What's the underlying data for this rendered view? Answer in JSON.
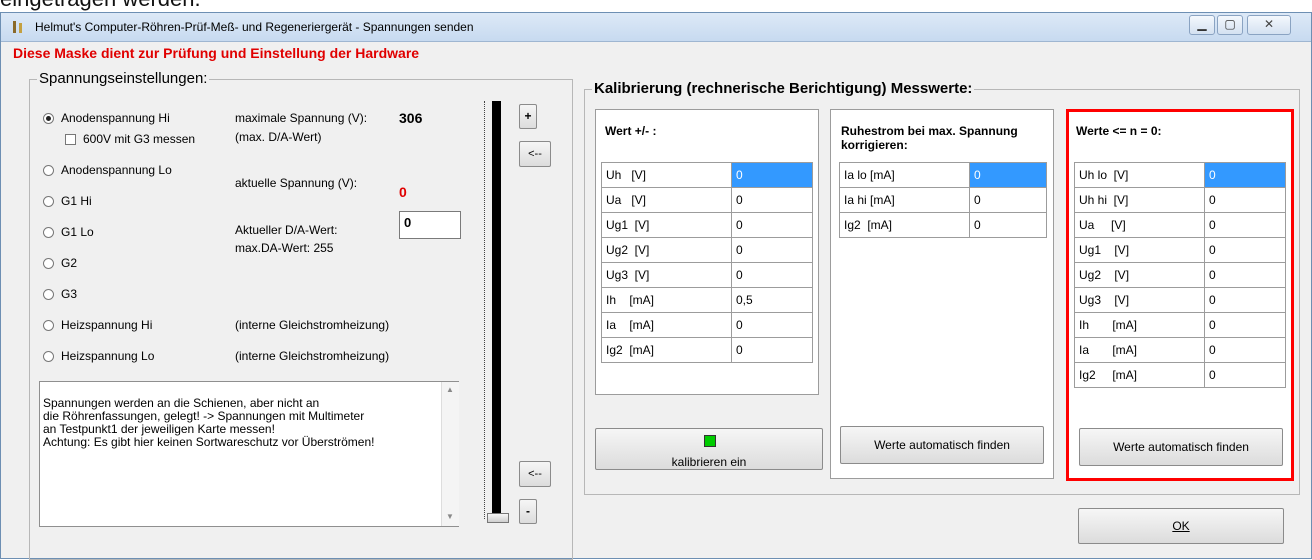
{
  "background_text": "eingetragen werden.",
  "window": {
    "title": "Helmut's Computer-Röhren-Prüf-Meß- und Regeneriergerät - Spannungen senden",
    "buttons": {
      "minimize": "▁",
      "maximize": "▢",
      "close": "✕"
    }
  },
  "header": "Diese Maske dient zur Prüfung und Einstellung der Hardware",
  "voltage_group": {
    "caption": "Spannungseinstellungen:",
    "options": [
      "Anodenspannung Hi",
      "Anodenspannung Lo",
      "G1 Hi",
      "G1 Lo",
      "G2",
      "G3",
      "Heizspannung Hi",
      "Heizspannung Lo"
    ],
    "selected_index": 0,
    "checkbox_label": "600V mit G3 messen",
    "max_voltage_label": "maximale Spannung (V):",
    "max_voltage_value": "306",
    "max_da_label": "(max. D/A-Wert)",
    "current_voltage_label": "aktuelle Spannung (V):",
    "current_voltage_value": "0",
    "current_da_label": "Aktueller D/A-Wert:",
    "current_da_value": "0",
    "max_da_value_label": "max.DA-Wert: 255",
    "heater_note_hi": "(interne Gleichstromheizung)",
    "heater_note_lo": "(interne Gleichstromheizung)",
    "memo_text": "Spannungen werden an die Schienen, aber nicht an\ndie Röhrenfassungen, gelegt! -> Spannungen mit Multimeter\nan Testpunkt1 der jeweiligen Karte messen!\nAchtung: Es gibt hier keinen Sortwareschutz vor Überströmen!",
    "slider_level": 0,
    "btn_plus": "+",
    "btn_minus": "-",
    "btn_arrow_top": "<--",
    "btn_arrow_bottom": "<--"
  },
  "calibration_group": {
    "caption": "Kalibrierung (rechnerische Berichtigung) Messwerte:",
    "panel1": {
      "title": "Wert +/- :",
      "rows": [
        [
          "Uh   [V]",
          "0"
        ],
        [
          "Ua   [V]",
          "0"
        ],
        [
          "Ug1  [V]",
          "0"
        ],
        [
          "Ug2  [V]",
          "0"
        ],
        [
          "Ug3  [V]",
          "0"
        ],
        [
          "Ih    [mA]",
          "0,5"
        ],
        [
          "Ia    [mA]",
          "0"
        ],
        [
          "Ig2  [mA]",
          "0"
        ]
      ]
    },
    "panel2": {
      "title": "Ruhestrom bei max. Spannung korrigieren:",
      "rows": [
        [
          "Ia lo [mA]",
          "0"
        ],
        [
          "Ia hi [mA]",
          "0"
        ],
        [
          "Ig2  [mA]",
          "0"
        ]
      ],
      "button": "Werte automatisch finden"
    },
    "panel3": {
      "title": "Werte <= n = 0:",
      "rows": [
        [
          "Uh lo  [V]",
          "0"
        ],
        [
          "Uh hi  [V]",
          "0"
        ],
        [
          "Ua     [V]",
          "0"
        ],
        [
          "Ug1    [V]",
          "0"
        ],
        [
          "Ug2    [V]",
          "0"
        ],
        [
          "Ug3    [V]",
          "0"
        ],
        [
          "Ih       [mA]",
          "0"
        ],
        [
          "Ia       [mA]",
          "0"
        ],
        [
          "Ig2     [mA]",
          "0"
        ]
      ],
      "button": "Werte automatisch finden"
    },
    "calibrate_button": "kalibrieren ein",
    "indicator_color": "#00cc00"
  },
  "ok_button": "OK",
  "colors": {
    "header_red": "#e00000",
    "highlight_border": "#ff0000",
    "selection": "#3399ff"
  }
}
